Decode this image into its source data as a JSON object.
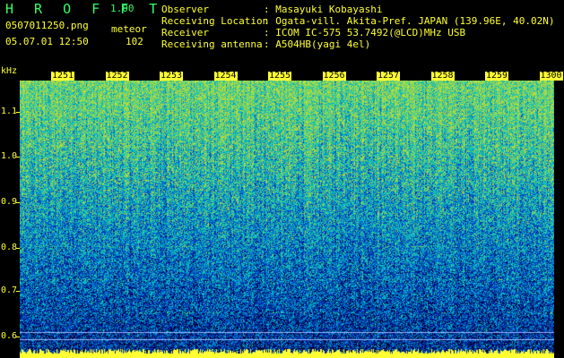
{
  "app": {
    "title": "H R O F F T",
    "version": "1.00"
  },
  "file": {
    "name": "0507011250.png",
    "datetime": "05.07.01 12:50"
  },
  "event": {
    "label": "meteor",
    "count": "102"
  },
  "info": [
    {
      "label": "Observer",
      "value": "Masayuki Kobayashi"
    },
    {
      "label": "Receiving Location",
      "value": "Ogata-vill. Akita-Pref. JAPAN (139.96E, 40.02N)"
    },
    {
      "label": "Receiver",
      "value": "ICOM IC-575 53.7492(@LCD)MHz USB"
    },
    {
      "label": "Receiving antenna",
      "value": "A504HB(yagi 4el)"
    }
  ],
  "axis": {
    "unit": "kHz",
    "freq_labels": [
      "1.1",
      "1.0",
      "0.9",
      "0.8",
      "0.7",
      "0.6"
    ],
    "time_labels": [
      "1251",
      "1252",
      "1253",
      "1254",
      "1255",
      "1256",
      "1257",
      "1258",
      "1259",
      "1300"
    ]
  },
  "colors": {
    "label": "#ffff33",
    "title": "#33ff66",
    "background": "#000000"
  }
}
